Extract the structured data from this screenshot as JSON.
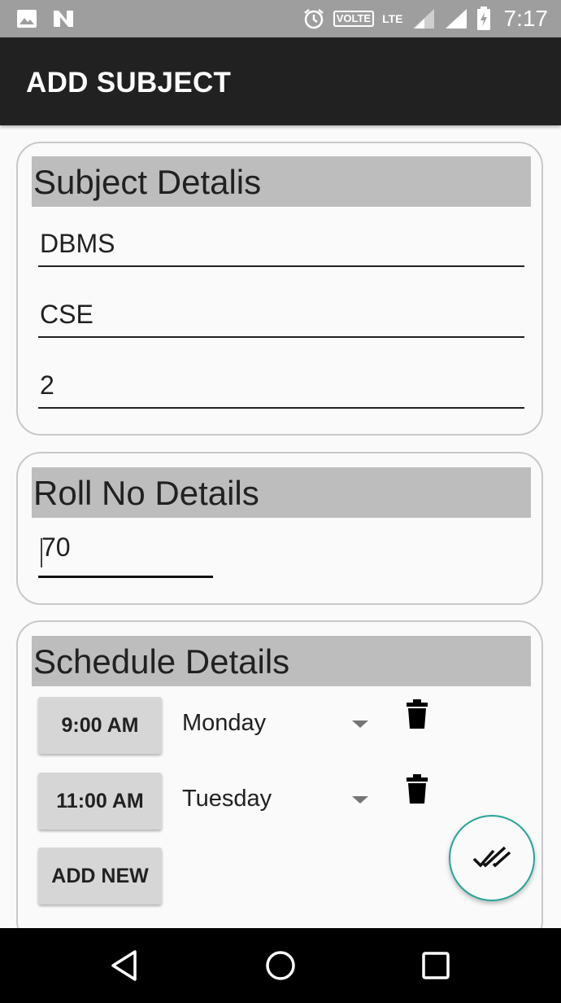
{
  "status_bar": {
    "time": "7:17",
    "volte_label": "VOLTE",
    "lte_label": "LTE",
    "icons": [
      "image-icon",
      "n-icon",
      "alarm-icon",
      "volte-icon",
      "lte-icon",
      "signal-icon",
      "signal-icon",
      "battery-charging-icon"
    ]
  },
  "app_bar": {
    "title": "ADD SUBJECT"
  },
  "subject_section": {
    "header": "Subject Detalis",
    "subject_name": "DBMS",
    "department": "CSE",
    "semester": "2"
  },
  "roll_section": {
    "header": "Roll No Details",
    "roll_no": "70"
  },
  "schedule_section": {
    "header": "Schedule Details",
    "rows": [
      {
        "time": "9:00 AM",
        "day": "Monday"
      },
      {
        "time": "11:00 AM",
        "day": "Tuesday"
      }
    ],
    "add_new_label": "ADD NEW"
  },
  "fab": {
    "icon": "double-check-icon",
    "color": "#26a69a"
  },
  "colors": {
    "app_bar": "#212121",
    "status_bar": "#9e9e9e",
    "section_header": "#bdbdbd",
    "button": "#d6d6d6"
  }
}
